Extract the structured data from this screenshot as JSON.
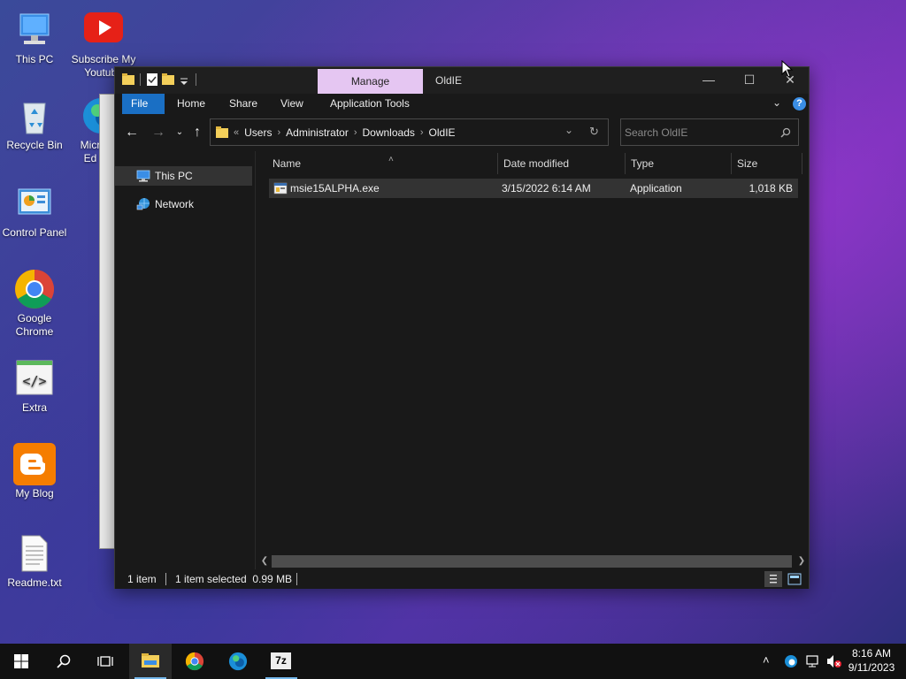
{
  "desktop": {
    "icons": [
      {
        "label": "This PC",
        "icon": "this-pc-icon"
      },
      {
        "label": "Subscribe My Youtube",
        "icon": "youtube-icon"
      },
      {
        "label": "Recycle Bin",
        "icon": "recycle-bin-icon"
      },
      {
        "label": "Micr\nEd",
        "icon": "edge-icon"
      },
      {
        "label": "Control Panel",
        "icon": "control-panel-icon"
      },
      {
        "label": "Google Chrome",
        "icon": "chrome-icon"
      },
      {
        "label": "Extra",
        "icon": "code-icon"
      },
      {
        "label": "My Blog",
        "icon": "blogger-icon"
      },
      {
        "label": "Readme.txt",
        "icon": "text-file-icon"
      }
    ]
  },
  "explorer": {
    "title": "OldIE",
    "manage_tab": "Manage",
    "ribbon_tabs": [
      "File",
      "Home",
      "Share",
      "View",
      "Application Tools"
    ],
    "breadcrumb": [
      "Users",
      "Administrator",
      "Downloads",
      "OldIE"
    ],
    "search_placeholder": "Search OldIE",
    "nav_items": [
      {
        "label": "This PC",
        "selected": true
      },
      {
        "label": "Network",
        "selected": false
      }
    ],
    "columns": [
      "Name",
      "Date modified",
      "Type",
      "Size"
    ],
    "files": [
      {
        "name": "msie15ALPHA.exe",
        "date": "3/15/2022 6:14 AM",
        "type": "Application",
        "size": "1,018 KB"
      }
    ],
    "status": {
      "count": "1 item",
      "selected": "1 item selected  0.99 MB"
    }
  },
  "taskbar": {
    "time": "8:16 AM",
    "date": "9/11/2023",
    "apps": [
      "start",
      "search",
      "task-view",
      "file-explorer",
      "chrome",
      "edge",
      "7zip"
    ],
    "seven_zip_label": "7z"
  },
  "colors": {
    "accent": "#1a6fc4",
    "manage_tab": "#e5c6f2",
    "window_bg": "#191919"
  }
}
